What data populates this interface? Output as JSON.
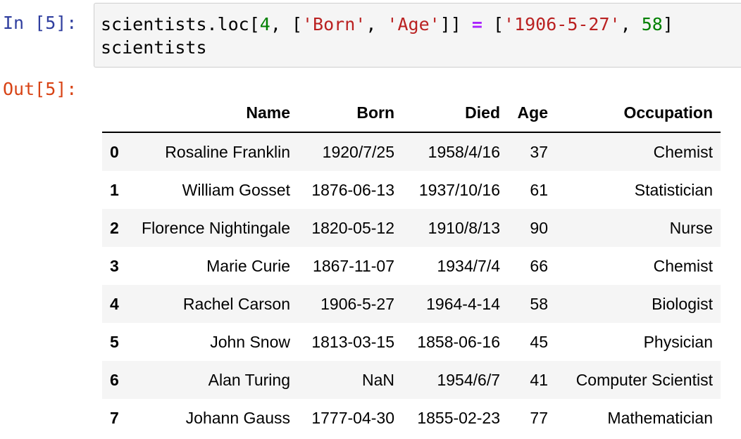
{
  "cell_input": {
    "prompt": "In [5]:",
    "code": {
      "line1": {
        "t1": "scientists.loc[",
        "n1": "4",
        "t2": ", [",
        "s1": "'Born'",
        "t3": ", ",
        "s2": "'Age'",
        "t4": "]] ",
        "op": "=",
        "t5": " [",
        "s3": "'1906-5-27'",
        "t6": ", ",
        "n2": "58",
        "t7": "]"
      },
      "line2": "scientists"
    }
  },
  "cell_output": {
    "prompt": "Out[5]:"
  },
  "table": {
    "columns": [
      "",
      "Name",
      "Born",
      "Died",
      "Age",
      "Occupation"
    ],
    "rows": [
      {
        "index": "0",
        "name": "Rosaline Franklin",
        "born": "1920/7/25",
        "died": "1958/4/16",
        "age": "37",
        "occupation": "Chemist"
      },
      {
        "index": "1",
        "name": "William Gosset",
        "born": "1876-06-13",
        "died": "1937/10/16",
        "age": "61",
        "occupation": "Statistician"
      },
      {
        "index": "2",
        "name": "Florence Nightingale",
        "born": "1820-05-12",
        "died": "1910/8/13",
        "age": "90",
        "occupation": "Nurse"
      },
      {
        "index": "3",
        "name": "Marie Curie",
        "born": "1867-11-07",
        "died": "1934/7/4",
        "age": "66",
        "occupation": "Chemist"
      },
      {
        "index": "4",
        "name": "Rachel Carson",
        "born": "1906-5-27",
        "died": "1964-4-14",
        "age": "58",
        "occupation": "Biologist"
      },
      {
        "index": "5",
        "name": "John Snow",
        "born": "1813-03-15",
        "died": "1858-06-16",
        "age": "45",
        "occupation": "Physician"
      },
      {
        "index": "6",
        "name": "Alan Turing",
        "born": "NaN",
        "died": "1954/6/7",
        "age": "41",
        "occupation": "Computer Scientist"
      },
      {
        "index": "7",
        "name": "Johann Gauss",
        "born": "1777-04-30",
        "died": "1855-02-23",
        "age": "77",
        "occupation": "Mathematician"
      }
    ]
  },
  "colors": {
    "prompt_in": "#303f9f",
    "prompt_out": "#d84315",
    "code_number": "#008000",
    "code_string": "#ba2121",
    "code_operator": "#aa22ff",
    "cell_background": "#f5f5f5",
    "row_stripe": "#f5f5f5"
  }
}
